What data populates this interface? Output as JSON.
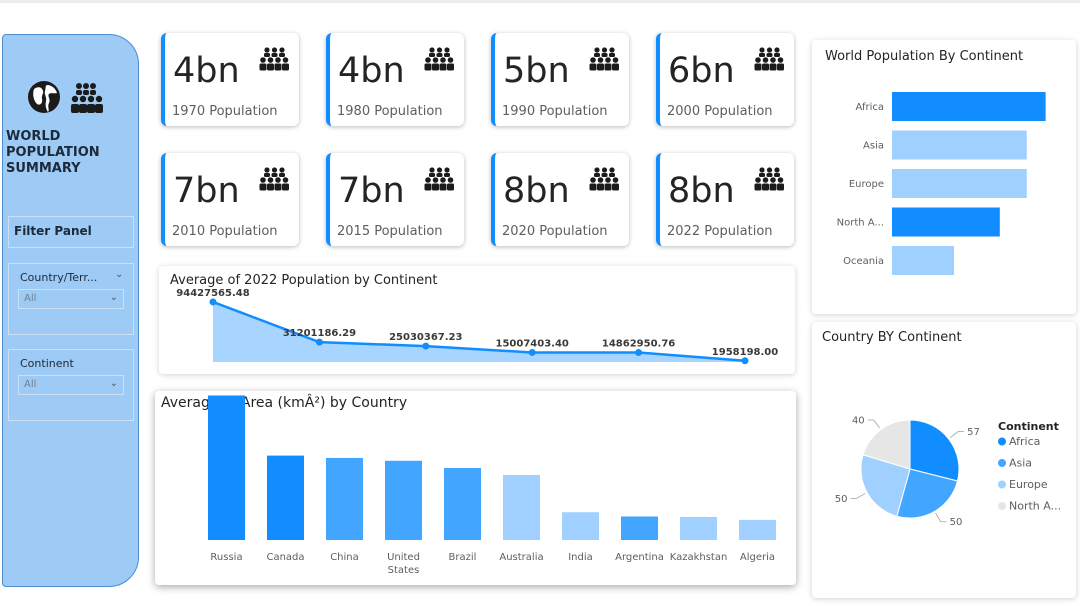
{
  "sidebar": {
    "title": "WORLD POPULATION SUMMARY",
    "filter_panel_label": "Filter Panel",
    "slicers": [
      {
        "label": "Country/Terr...",
        "value": "All"
      },
      {
        "label": "Continent",
        "value": "All"
      }
    ],
    "icons": [
      "globe-icon",
      "people-group-icon"
    ]
  },
  "kpis": [
    {
      "value": "4bn",
      "label": "1970 Population"
    },
    {
      "value": "4bn",
      "label": "1980 Population"
    },
    {
      "value": "5bn",
      "label": "1990 Population"
    },
    {
      "value": "6bn",
      "label": "2000 Population"
    },
    {
      "value": "7bn",
      "label": "2010 Population"
    },
    {
      "value": "7bn",
      "label": "2015 Population"
    },
    {
      "value": "8bn",
      "label": "2020 Population"
    },
    {
      "value": "8bn",
      "label": "2022 Population"
    }
  ],
  "colors": {
    "accent": "#118dff",
    "light": "#9fd0ff",
    "mid": "#42a5ff",
    "sidebar": "#9ecbf5",
    "gray": "#e6e6e6"
  },
  "chart_data": [
    {
      "type": "bar",
      "orientation": "horizontal",
      "title": "World Population By Continent",
      "categories": [
        "Africa",
        "Asia",
        "Europe",
        "North A...",
        "Oceania"
      ],
      "values": [
        57,
        50,
        50,
        40,
        23
      ],
      "xlim": [
        0,
        60
      ],
      "colors": [
        "#118dff",
        "#9fd0ff",
        "#9fd0ff",
        "#118dff",
        "#9fd0ff"
      ]
    },
    {
      "type": "area",
      "title": "Average of 2022 Population by Continent",
      "data_labels": [
        "94427565.48",
        "31201186.29",
        "25030367.23",
        "15007403.40",
        "14862950.76",
        "1958198.00"
      ],
      "values": [
        94427565.48,
        31201186.29,
        25030367.23,
        15007403.4,
        14862950.76,
        1958198.0
      ],
      "ylim": [
        0,
        100000000
      ]
    },
    {
      "type": "bar",
      "title": "Average of Area (kmÂ²) by Country",
      "categories": [
        "Russia",
        "Canada",
        "China",
        "United States",
        "Brazil",
        "Australia",
        "India",
        "Argentina",
        "Kazakhstan",
        "Algeria"
      ],
      "values": [
        17098242,
        9984670,
        9706961,
        9372610,
        8515767,
        7692024,
        3287590,
        2780400,
        2724900,
        2381741
      ],
      "ylim": [
        0,
        20000000
      ],
      "colors": [
        "#118dff",
        "#118dff",
        "#42a5ff",
        "#42a5ff",
        "#42a5ff",
        "#9fd0ff",
        "#9fd0ff",
        "#42a5ff",
        "#9fd0ff",
        "#9fd0ff"
      ]
    },
    {
      "type": "pie",
      "title": "Country BY Continent",
      "legend_title": "Continent",
      "legend_position": "right",
      "categories": [
        "Africa",
        "Asia",
        "Europe",
        "North A..."
      ],
      "values": [
        57,
        50,
        50,
        40
      ],
      "colors": [
        "#118dff",
        "#42a5ff",
        "#9fd0ff",
        "#e6e6e6"
      ]
    }
  ]
}
